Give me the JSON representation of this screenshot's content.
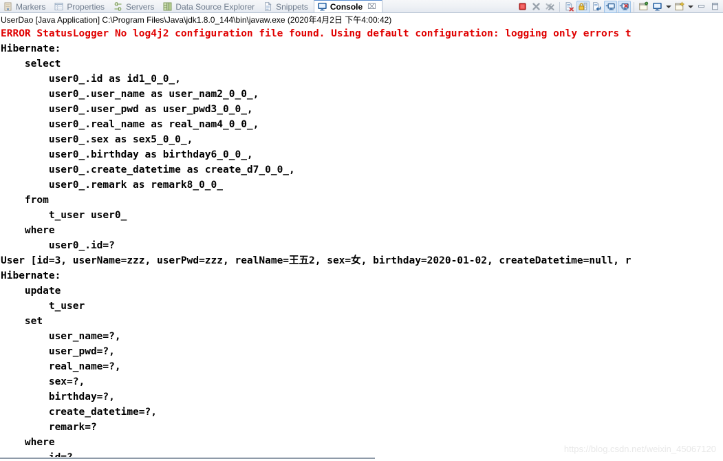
{
  "window": {
    "view": "Console"
  },
  "tabbar": {
    "tabs": [
      {
        "label": "Markers",
        "icon": "markers-icon",
        "active": false
      },
      {
        "label": "Properties",
        "icon": "properties-icon",
        "active": false
      },
      {
        "label": "Servers",
        "icon": "servers-icon",
        "active": false
      },
      {
        "label": "Data Source Explorer",
        "icon": "data-source-explorer-icon",
        "active": false
      },
      {
        "label": "Snippets",
        "icon": "snippets-icon",
        "active": false
      },
      {
        "label": "Console",
        "icon": "console-icon",
        "active": true
      }
    ],
    "close_glyph": "⌧",
    "toolbar": [
      {
        "name": "terminate-button",
        "icon": "stop-square-icon",
        "toggled": false
      },
      {
        "name": "remove-launch-button",
        "icon": "gray-x-icon",
        "toggled": false
      },
      {
        "name": "remove-all-terminated-button",
        "icon": "gray-double-x-icon",
        "toggled": false
      },
      {
        "name": "separator-1",
        "icon": "separator",
        "toggled": false
      },
      {
        "name": "clear-console-button",
        "icon": "clear-console-icon",
        "toggled": false
      },
      {
        "name": "scroll-lock-button",
        "icon": "lock-icon",
        "toggled": true
      },
      {
        "name": "word-wrap-button",
        "icon": "word-wrap-icon",
        "toggled": false
      },
      {
        "name": "show-console-on-output-button",
        "icon": "show-console-standard-icon",
        "toggled": true
      },
      {
        "name": "show-console-on-error-button",
        "icon": "show-console-error-icon",
        "toggled": true
      },
      {
        "name": "separator-2",
        "icon": "separator",
        "toggled": false
      },
      {
        "name": "pin-console-button",
        "icon": "pin-icon",
        "toggled": false
      },
      {
        "name": "display-selected-console-button",
        "icon": "display-console-icon",
        "toggled": false
      },
      {
        "name": "display-selected-console-dropdown",
        "icon": "chevron-down-icon",
        "toggled": false
      },
      {
        "name": "open-console-button",
        "icon": "new-console-icon",
        "toggled": false
      },
      {
        "name": "open-console-dropdown",
        "icon": "chevron-down-icon",
        "toggled": false
      },
      {
        "name": "minimize-button",
        "icon": "minimize-icon",
        "toggled": false
      },
      {
        "name": "maximize-button",
        "icon": "maximize-icon",
        "toggled": false
      }
    ]
  },
  "process": {
    "line": "UserDao [Java Application] C:\\Program Files\\Java\\jdk1.8.0_144\\bin\\javaw.exe (2020年4月2日 下午4:00:42)"
  },
  "console": {
    "lines": [
      {
        "text": "ERROR StatusLogger No log4j2 configuration file found. Using default configuration: logging only errors t",
        "error": true
      },
      {
        "text": "Hibernate: ",
        "error": false
      },
      {
        "text": "    select",
        "error": false
      },
      {
        "text": "        user0_.id as id1_0_0_,",
        "error": false
      },
      {
        "text": "        user0_.user_name as user_nam2_0_0_,",
        "error": false
      },
      {
        "text": "        user0_.user_pwd as user_pwd3_0_0_,",
        "error": false
      },
      {
        "text": "        user0_.real_name as real_nam4_0_0_,",
        "error": false
      },
      {
        "text": "        user0_.sex as sex5_0_0_,",
        "error": false
      },
      {
        "text": "        user0_.birthday as birthday6_0_0_,",
        "error": false
      },
      {
        "text": "        user0_.create_datetime as create_d7_0_0_,",
        "error": false
      },
      {
        "text": "        user0_.remark as remark8_0_0_ ",
        "error": false
      },
      {
        "text": "    from",
        "error": false
      },
      {
        "text": "        t_user user0_ ",
        "error": false
      },
      {
        "text": "    where",
        "error": false
      },
      {
        "text": "        user0_.id=?",
        "error": false
      },
      {
        "text": "User [id=3, userName=zzz, userPwd=zzz, realName=王五2, sex=女, birthday=2020-01-02, createDatetime=null, r",
        "error": false
      },
      {
        "text": "Hibernate: ",
        "error": false
      },
      {
        "text": "    update",
        "error": false
      },
      {
        "text": "        t_user ",
        "error": false
      },
      {
        "text": "    set",
        "error": false
      },
      {
        "text": "        user_name=?,",
        "error": false
      },
      {
        "text": "        user_pwd=?,",
        "error": false
      },
      {
        "text": "        real_name=?,",
        "error": false
      },
      {
        "text": "        sex=?,",
        "error": false
      },
      {
        "text": "        birthday=?,",
        "error": false
      },
      {
        "text": "        create_datetime=?,",
        "error": false
      },
      {
        "text": "        remark=? ",
        "error": false
      },
      {
        "text": "    where",
        "error": false
      },
      {
        "text": "        id=?",
        "error": false
      }
    ]
  },
  "watermark": {
    "text": "https://blog.csdn.net/weixin_45067120"
  },
  "colors": {
    "error_text": "#e00000",
    "text": "#000000",
    "tab_active_bg": "#ffffff",
    "tab_inactive_text": "#6e7b8c",
    "tabbar_bg": "#eef1f5",
    "toggled_button_bg": "#d6e6f7"
  }
}
